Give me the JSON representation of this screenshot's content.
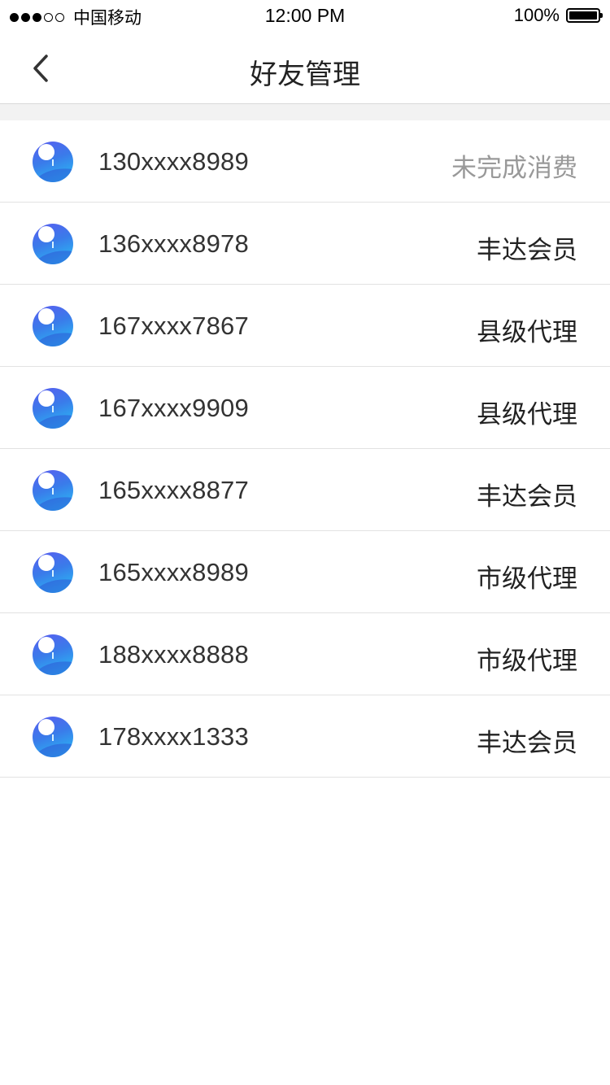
{
  "status_bar": {
    "signal_dots_filled": 3,
    "signal_dots_total": 5,
    "carrier": "中国移动",
    "time": "12:00 PM",
    "battery_percent": "100%",
    "battery_level": 1.0
  },
  "nav": {
    "back_icon": "chevron-left-icon",
    "title": "好友管理"
  },
  "colors": {
    "muted_status": "#999999",
    "avatar_gradient": [
      "#5a5df0",
      "#3a7bea",
      "#27c4f5"
    ]
  },
  "friends": [
    {
      "phone": "130xxxx8989",
      "status": "未完成消费",
      "muted": true
    },
    {
      "phone": "136xxxx8978",
      "status": "丰达会员",
      "muted": false
    },
    {
      "phone": "167xxxx7867",
      "status": "县级代理",
      "muted": false
    },
    {
      "phone": "167xxxx9909",
      "status": "县级代理",
      "muted": false
    },
    {
      "phone": "165xxxx8877",
      "status": "丰达会员",
      "muted": false
    },
    {
      "phone": "165xxxx8989",
      "status": "市级代理",
      "muted": false
    },
    {
      "phone": "188xxxx8888",
      "status": "市级代理",
      "muted": false
    },
    {
      "phone": "178xxxx1333",
      "status": "丰达会员",
      "muted": false
    }
  ]
}
